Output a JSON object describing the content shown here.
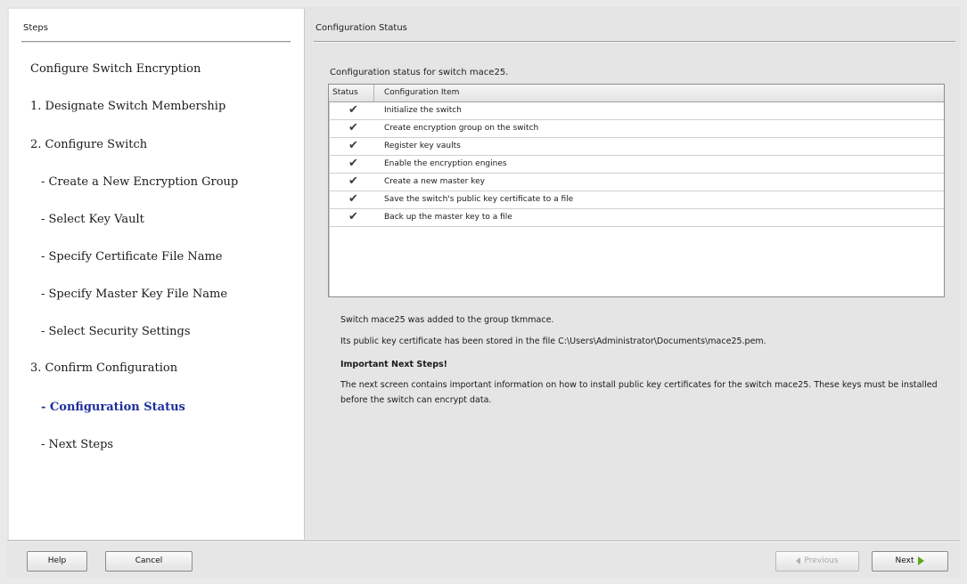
{
  "steps_panel": {
    "header": "Steps",
    "items": [
      {
        "label": "Configure Switch Encryption"
      },
      {
        "label": "1. Designate Switch Membership"
      },
      {
        "label": "2. Configure Switch"
      },
      {
        "label": "- Create a New Encryption Group"
      },
      {
        "label": "- Select Key Vault"
      },
      {
        "label": "- Specify Certificate File Name"
      },
      {
        "label": "- Specify Master Key File Name"
      },
      {
        "label": "- Select Security Settings"
      },
      {
        "label": "3. Confirm Configuration"
      },
      {
        "label": "- Configuration Status"
      },
      {
        "label": "- Next Steps"
      }
    ]
  },
  "content": {
    "title": "Configuration Status",
    "intro": "Configuration status for switch mace25.",
    "table": {
      "columns": [
        "Status",
        "Configuration Item"
      ],
      "rows": [
        {
          "status": "✔",
          "item": "Initialize the switch"
        },
        {
          "status": "✔",
          "item": "Create encryption group on the switch"
        },
        {
          "status": "✔",
          "item": "Register key vaults"
        },
        {
          "status": "✔",
          "item": "Enable the encryption engines"
        },
        {
          "status": "✔",
          "item": "Create a new master key"
        },
        {
          "status": "✔",
          "item": "Save the switch's public key certificate to a file"
        },
        {
          "status": "✔",
          "item": "Back up the master key to a file"
        }
      ]
    },
    "message_added": "Switch mace25 was added to the group tkmmace.",
    "message_cert": "Its public key certificate has been stored in the file C:\\Users\\Administrator\\Documents\\mace25.pem.",
    "next_steps_heading": "Important Next Steps!",
    "next_steps_text": "The next screen contains important information on how to install public key certificates for the switch mace25. These keys must be installed before the switch can encrypt data."
  },
  "buttons": {
    "help": "Help",
    "cancel": "Cancel",
    "previous": "Previous",
    "next": "Next"
  },
  "colors": {
    "current_step": "#1d2e9a",
    "next_arrow": "#5aa81e"
  }
}
